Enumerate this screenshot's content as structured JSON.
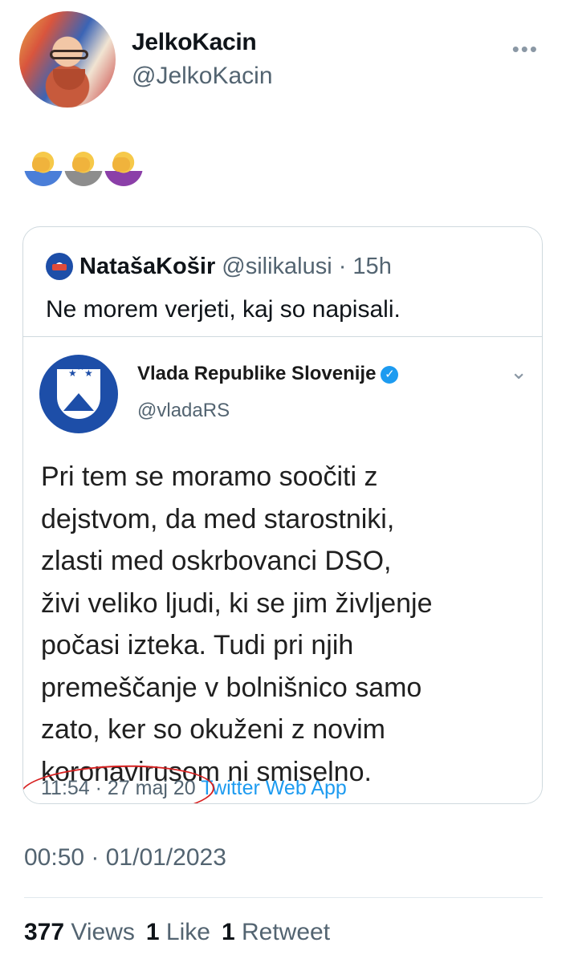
{
  "tweet": {
    "author_name": "JelkoKacin",
    "author_handle": "@JelkoKacin",
    "more_icon": "more-horizontal-icon",
    "emojis": [
      "man-facepalming-emoji",
      "man-facepalming-emoji",
      "woman-facepalming-emoji"
    ],
    "timestamp": "00:50 · 01/01/2023"
  },
  "quoted": {
    "name": "NatašaKošir",
    "handle": "@silikalusi · 15h",
    "text": "Ne morem verjeti, kaj so napisali."
  },
  "screenshot": {
    "name": "Vlada Republike Slovenije",
    "handle": "@vladaRS",
    "text": "Pri tem se moramo soočiti z\ndejstvom, da med starostniki,\nzlasti med oskrbovanci DSO,\nživi veliko ljudi, ki se jim življenje\npočasi izteka. Tudi pri njih\npremeščanje v bolnišnico samo\nzato, ker so okuženi z novim\nkoronavirusom ni smiselno.",
    "time": "11:54 · 27 maj 20",
    "app": "Twitter Web App"
  },
  "stats": {
    "views_count": "377",
    "views_label": "Views",
    "likes_count": "1",
    "likes_label": "Like",
    "retweets_count": "1",
    "retweets_label": "Retweet"
  },
  "colors": {
    "accent": "#1d9bf0",
    "muted_text": "#536471",
    "annotation_red": "#d72020",
    "gov_blue": "#1d4ea8"
  }
}
